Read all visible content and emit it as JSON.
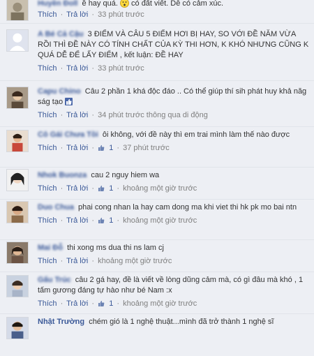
{
  "common": {
    "like_label": "Thích",
    "reply_label": "Trả lời",
    "sep": "·"
  },
  "comments": [
    {
      "author": "Huyền Đoll",
      "text_before": "ề hay quá.",
      "text_after": "có đất viết. Dễ có cảm xúc.",
      "time": "33 phút trước",
      "has_emoji": true,
      "avatar_color": "#9a8f7a"
    },
    {
      "author": "A Bé Cả Cậu",
      "text": "3 ĐIỂM VÀ CÂU 5 ĐIỂM HƠI BỊ HAY, SO VỚI ĐỀ NĂM VỪA RỒI THÌ ĐỀ NÀY CÓ TÍNH CHẤT CỦA KỲ THI HƠN, K KHÓ NHƯNG CŨNG K QUÁ DỄ ĐỂ LẤY ĐIỂM , kết luận: ĐỀ HAY",
      "time": "33 phút trước",
      "avatar_color": "#dfe3ee"
    },
    {
      "author": "Capu Chino",
      "text": "Câu 2 phần 1 khá độc đáo .. Có thể giúp thí sih phát huy khả năg ság tạo",
      "time": "34 phút trước",
      "extra": "thông qua di động",
      "has_thumb_inline": true,
      "avatar_color": "#7a6a5a"
    },
    {
      "author": "Cô Gái Chưa Tồi",
      "text": "ôi không, với đề này thì em trai mình làm thế nào được",
      "likes": "1",
      "time": "37 phút trước",
      "avatar_color": "#b85c4c"
    },
    {
      "author": "Nhok Buonza",
      "text": "cau 2 nguy hiem wa",
      "likes": "1",
      "time": "khoảng một giờ trước",
      "avatar_color": "#3a3a3a"
    },
    {
      "author": "Duo Chua",
      "text": "phai cong nhan la hay cam dong ma khi viet thi hk pk mo bai ntn",
      "likes": "1",
      "time": "khoảng một giờ trước",
      "avatar_color": "#8c6b4a"
    },
    {
      "author": "Mai Đỗ",
      "text": "thi xong ms dua thi ns lam cj",
      "time": "khoảng một giờ trước",
      "avatar_color": "#6b5344"
    },
    {
      "author": "Gấu Trúc",
      "text": "câu 2 gá hay, đề là viết về lòng dũng cảm mà, có gì đâu mà khó , 1 tấm gương đáng tự hào như bé Nam :x",
      "likes": "1",
      "time": "khoảng một giờ trước",
      "avatar_color": "#a8b4c8"
    },
    {
      "author": "Nhật Trường",
      "author_clear": true,
      "text": "chém gió là 1 nghệ thuật...mình đã trở thành 1 nghệ sĩ",
      "avatar_color": "#4a5f8a"
    }
  ]
}
